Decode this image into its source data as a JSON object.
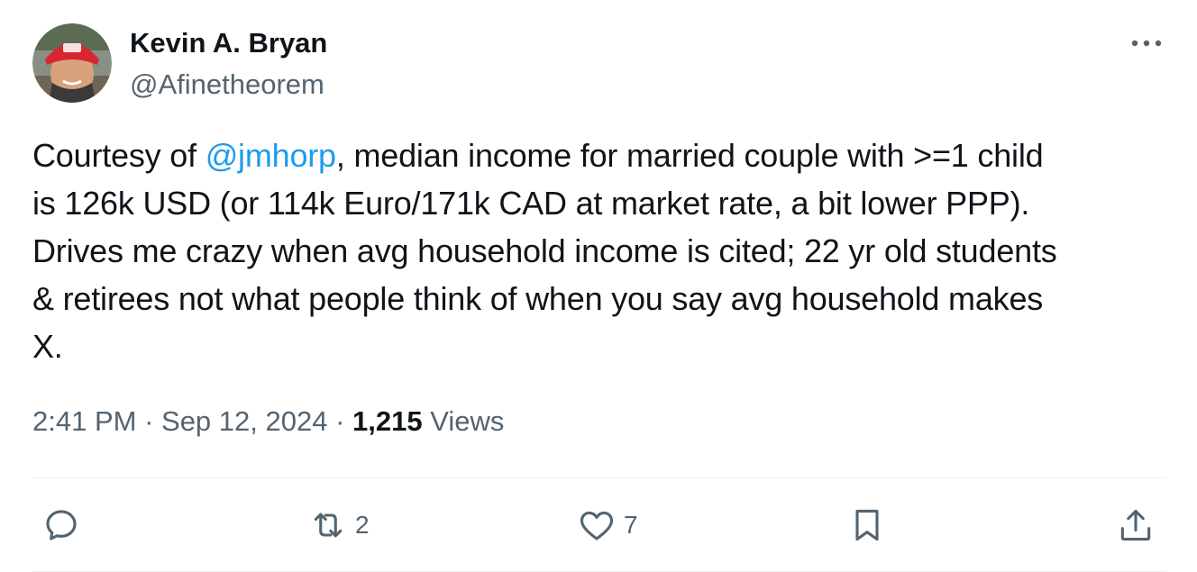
{
  "author": {
    "name": "Kevin A. Bryan",
    "handle": "@Afinetheorem",
    "avatar_icon": "user-avatar-photo"
  },
  "tweet": {
    "lines": [
      {
        "pre": "Courtesy of ",
        "mention": "@jmhorp",
        "post": ", median income for married couple with >=1 child"
      },
      {
        "text": "is 126k USD (or 114k Euro/171k CAD at market rate, a bit lower PPP)."
      },
      {
        "text": "Drives me crazy when avg household income is cited; 22 yr old students"
      },
      {
        "text": "& retirees not what people think of when you say avg household makes"
      },
      {
        "text": "X."
      }
    ]
  },
  "meta": {
    "time": "2:41 PM",
    "sep1": " · ",
    "date": "Sep 12, 2024",
    "sep2": " · ",
    "views_count": "1,215",
    "views_label": " Views"
  },
  "actions": {
    "reply": {
      "icon": "reply-icon",
      "count": ""
    },
    "retweet": {
      "icon": "retweet-icon",
      "count": "2"
    },
    "like": {
      "icon": "heart-icon",
      "count": "7"
    },
    "bookmark": {
      "icon": "bookmark-icon",
      "count": ""
    },
    "share": {
      "icon": "share-icon",
      "count": ""
    }
  },
  "colors": {
    "link": "#1d9bf0",
    "secondary_text": "#536471",
    "primary_text": "#0f1419",
    "divider": "#eff3f4"
  }
}
